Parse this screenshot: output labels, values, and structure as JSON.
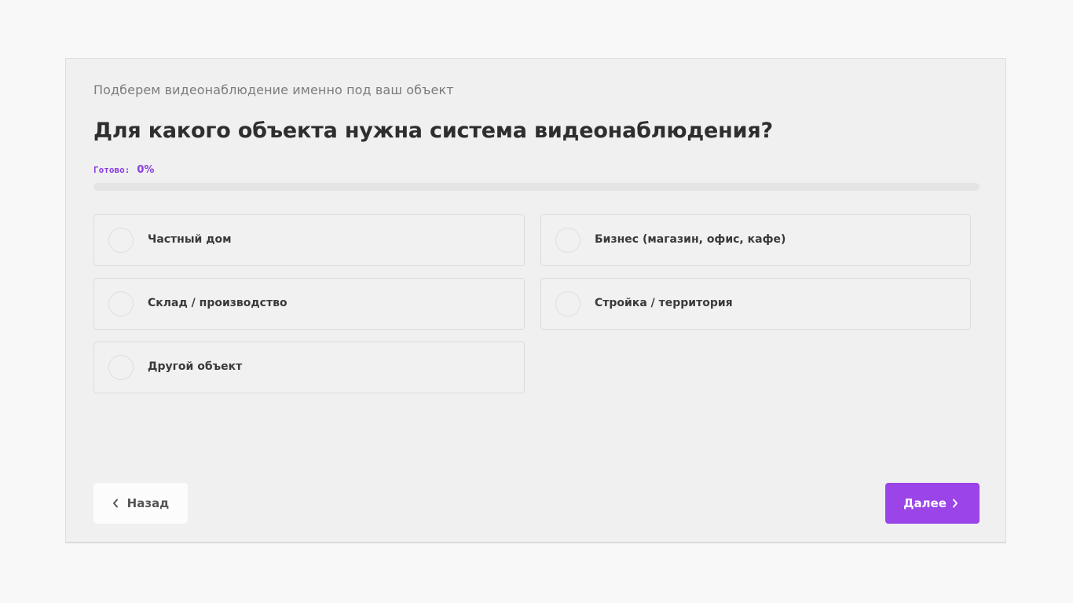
{
  "quiz": {
    "subtitle": "Подберем видеонаблюдение именно под ваш объект",
    "question": "Для какого объекта нужна система видеонаблюдения?",
    "progress": {
      "caption": "Готово:",
      "value_text": "0%",
      "value": 0
    },
    "options": [
      {
        "label": "Частный дом"
      },
      {
        "label": "Бизнес (магазин, офис, кафе)"
      },
      {
        "label": "Склад / производство"
      },
      {
        "label": "Стройка / территория"
      },
      {
        "label": "Другой объект"
      }
    ],
    "nav": {
      "back_label": "Назад",
      "next_label": "Далее"
    }
  },
  "colors": {
    "accent": "#9b45e8",
    "background": "#f8f8f8",
    "card": "#f0f0f0"
  },
  "icons": {
    "back": "chevron-left-icon",
    "next": "chevron-right-icon"
  }
}
